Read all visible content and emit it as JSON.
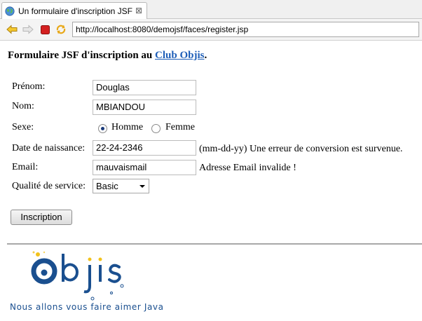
{
  "browser": {
    "tab_title": "Un formulaire d'inscription JSF",
    "tab_close": "⊠",
    "url": "http://localhost:8080/demojsf/faces/register.jsp"
  },
  "page": {
    "heading_prefix": "Formulaire JSF d'inscription au ",
    "heading_link": "Club Objis",
    "heading_suffix": "."
  },
  "form": {
    "prenom": {
      "label": "Prénom:",
      "value": "Douglas"
    },
    "nom": {
      "label": "Nom:",
      "value": "MBIANDOU"
    },
    "sexe": {
      "label": "Sexe:",
      "options": [
        {
          "label": "Homme",
          "checked": true
        },
        {
          "label": "Femme",
          "checked": false
        }
      ]
    },
    "date": {
      "label": "Date de naissance:",
      "value": "22-24-2346",
      "hint": "(mm-dd-yy)",
      "error": "Une erreur de conversion est survenue."
    },
    "email": {
      "label": "Email:",
      "value": "mauvaismail",
      "error": "Adresse Email invalide !"
    },
    "qualite": {
      "label": "Qualité de service:",
      "selected": "Basic"
    },
    "submit_label": "Inscription"
  },
  "logo": {
    "wordmark": "Objis",
    "tagline": "Nous allons vous faire aimer Java",
    "colors": {
      "blue": "#1a4f8f",
      "yellow": "#f2c21b"
    }
  },
  "colors": {
    "link": "#1f5fb8",
    "stop": "#d42020",
    "arrow": "#e8a818"
  }
}
